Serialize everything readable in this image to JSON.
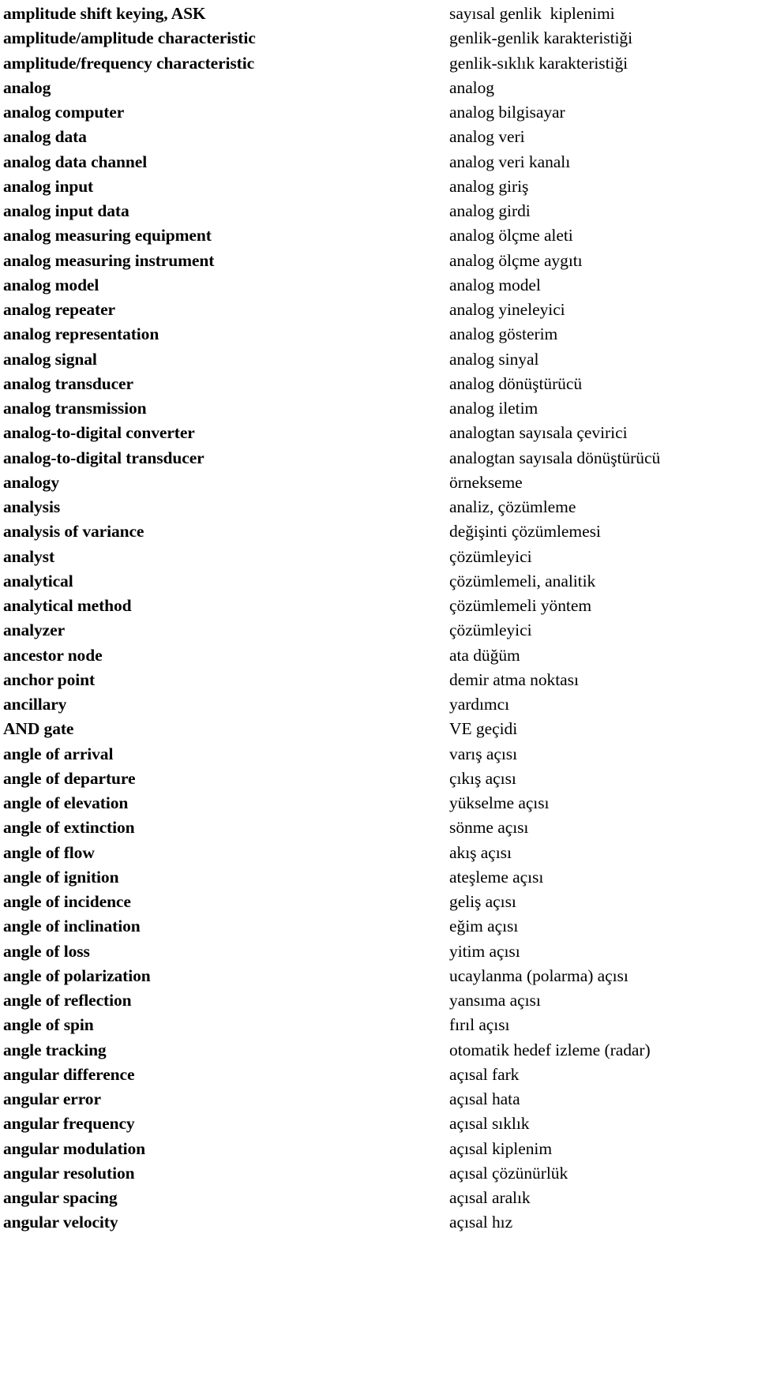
{
  "document": {
    "kind": "bilingual-glossary",
    "source_language": "English",
    "target_language": "Turkish",
    "background_color": "#ffffff",
    "text_color": "#000000"
  },
  "entries": [
    {
      "en": "amplitude shift keying, ASK",
      "tr": "sayısal genlik  kiplenimi"
    },
    {
      "en": "amplitude/amplitude characteristic",
      "tr": "genlik-genlik karakteristiği"
    },
    {
      "en": "amplitude/frequency characteristic",
      "tr": "genlik-sıklık karakteristiği"
    },
    {
      "en": "analog",
      "tr": "analog"
    },
    {
      "en": "analog computer",
      "tr": "analog bilgisayar"
    },
    {
      "en": "analog data",
      "tr": "analog veri"
    },
    {
      "en": "analog data channel",
      "tr": "analog veri kanalı"
    },
    {
      "en": "analog input",
      "tr": "analog giriş"
    },
    {
      "en": "analog input data",
      "tr": "analog girdi"
    },
    {
      "en": "analog measuring equipment",
      "tr": "analog ölçme aleti"
    },
    {
      "en": "analog measuring instrument",
      "tr": "analog ölçme aygıtı"
    },
    {
      "en": "analog model",
      "tr": "analog model"
    },
    {
      "en": "analog repeater",
      "tr": "analog yineleyici"
    },
    {
      "en": "analog representation",
      "tr": "analog gösterim"
    },
    {
      "en": "analog signal",
      "tr": "analog sinyal"
    },
    {
      "en": "analog transducer",
      "tr": "analog dönüştürücü"
    },
    {
      "en": "analog transmission",
      "tr": "analog iletim"
    },
    {
      "en": "analog-to-digital converter",
      "tr": "analogtan sayısala çevirici"
    },
    {
      "en": "analog-to-digital transducer",
      "tr": "analogtan sayısala dönüştürücü"
    },
    {
      "en": "analogy",
      "tr": "örnekseme"
    },
    {
      "en": "analysis",
      "tr": "analiz, çözümleme"
    },
    {
      "en": "analysis of variance",
      "tr": "değişinti çözümlemesi"
    },
    {
      "en": "analyst",
      "tr": "çözümleyici"
    },
    {
      "en": "analytical",
      "tr": "çözümlemeli, analitik"
    },
    {
      "en": "analytical method",
      "tr": "çözümlemeli yöntem"
    },
    {
      "en": "analyzer",
      "tr": "çözümleyici"
    },
    {
      "en": "ancestor node",
      "tr": "ata düğüm"
    },
    {
      "en": "anchor point",
      "tr": "demir atma noktası"
    },
    {
      "en": "ancillary",
      "tr": "yardımcı"
    },
    {
      "en": "AND gate",
      "tr": "VE geçidi"
    },
    {
      "en": "angle of arrival",
      "tr": "varış açısı"
    },
    {
      "en": "angle of departure",
      "tr": "çıkış açısı"
    },
    {
      "en": "angle of elevation",
      "tr": "yükselme açısı"
    },
    {
      "en": "angle of extinction",
      "tr": "sönme açısı"
    },
    {
      "en": "angle of flow",
      "tr": "akış açısı"
    },
    {
      "en": "angle of ignition",
      "tr": "ateşleme açısı"
    },
    {
      "en": "angle of incidence",
      "tr": "geliş açısı"
    },
    {
      "en": "angle of inclination",
      "tr": "eğim açısı"
    },
    {
      "en": "angle of loss",
      "tr": "yitim açısı"
    },
    {
      "en": "angle of polarization",
      "tr": "ucaylanma (polarma) açısı"
    },
    {
      "en": "angle of reflection",
      "tr": "yansıma açısı"
    },
    {
      "en": "angle of spin",
      "tr": "fırıl açısı"
    },
    {
      "en": "angle tracking",
      "tr": "otomatik hedef izleme (radar)"
    },
    {
      "en": "angular difference",
      "tr": "açısal fark"
    },
    {
      "en": "angular error",
      "tr": "açısal hata"
    },
    {
      "en": "angular frequency",
      "tr": "açısal sıklık"
    },
    {
      "en": "angular modulation",
      "tr": "açısal kiplenim"
    },
    {
      "en": "angular resolution",
      "tr": "açısal çözünürlük"
    },
    {
      "en": "angular spacing",
      "tr": "açısal aralık"
    },
    {
      "en": "angular velocity",
      "tr": "açısal hız"
    }
  ]
}
